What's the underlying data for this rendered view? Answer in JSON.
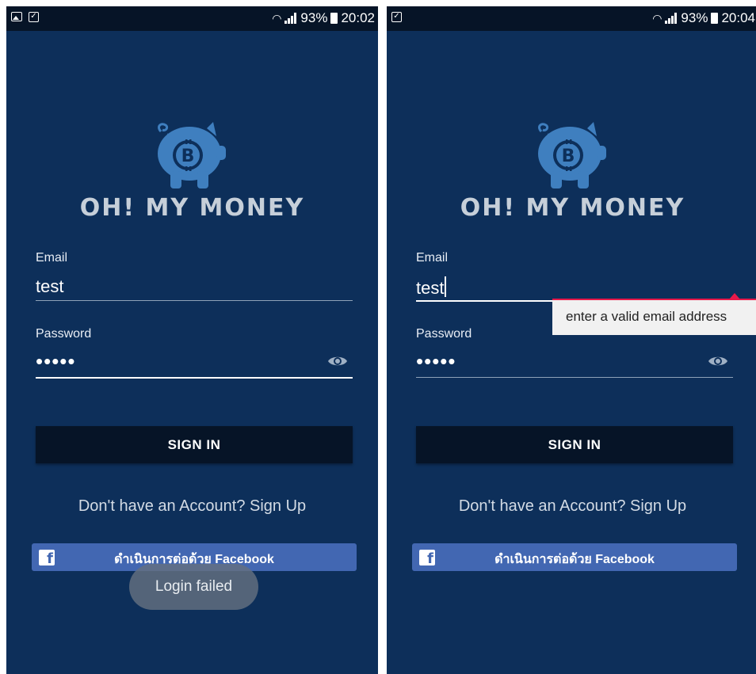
{
  "screens": [
    {
      "status": {
        "battery": "93%",
        "time": "20:02"
      },
      "app_title": "OH! MY MONEY",
      "email_label": "Email",
      "email_value": "test",
      "password_label": "Password",
      "password_value": "•••••",
      "signin_label": "SIGN IN",
      "signup_text": "Don't have an Account? Sign Up",
      "facebook_label": "ดำเนินการต่อด้วย Facebook",
      "toast": "Login failed"
    },
    {
      "status": {
        "battery": "93%",
        "time": "20:04"
      },
      "app_title": "OH! MY MONEY",
      "email_label": "Email",
      "email_value": "test",
      "password_label": "Password",
      "password_value": "•••••",
      "signin_label": "SIGN IN",
      "signup_text": "Don't have an Account? Sign Up",
      "facebook_label": "ดำเนินการต่อด้วย Facebook",
      "error_message": "enter a valid email address"
    }
  ],
  "icons": {
    "logo": "piggy-bank-bitcoin-icon",
    "password_toggle": "eye-icon",
    "facebook": "facebook-icon",
    "wifi": "wifi-icon",
    "signal": "signal-icon",
    "battery": "battery-icon"
  },
  "colors": {
    "background": "#0d2f5a",
    "status_bar": "#061427",
    "button": "#061427",
    "facebook": "#4267b2",
    "logo": "#3f7fbf",
    "error": "#e8194a"
  }
}
